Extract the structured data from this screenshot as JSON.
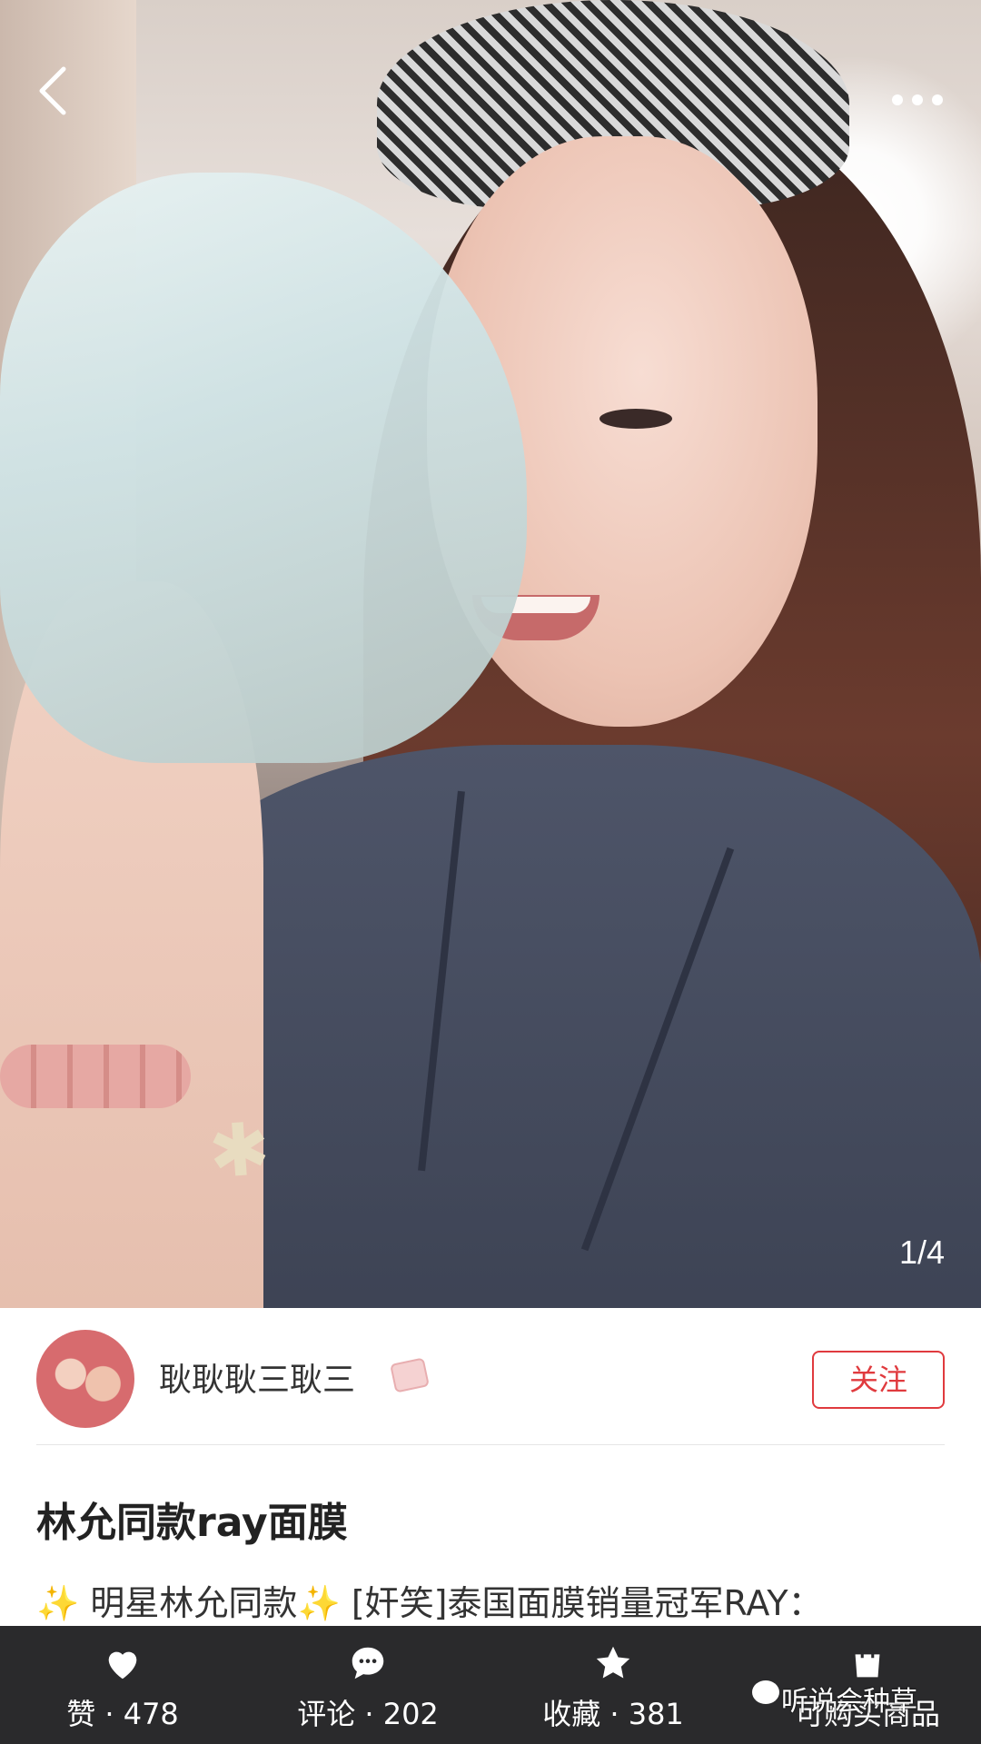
{
  "post": {
    "image_counter": "1/4",
    "author_name": "耿耿耿三耿三",
    "follow_label": "关注",
    "title": "林允同款ray面膜",
    "body_line": "明星林允同款",
    "body_line_rest": "[奸笑]泰国面膜销量冠军RAY："
  },
  "icons": {
    "back": "back-chevron-icon",
    "more": "more-dots-icon",
    "like": "heart-icon",
    "comment": "comment-bubble-icon",
    "collect": "star-icon",
    "shop": "shopping-bag-icon",
    "sparkle": "sparkle-icon"
  },
  "bottom_bar": {
    "like_label": "赞 · 478",
    "comment_label": "评论 · 202",
    "collect_label": "收藏 · 381",
    "shop_label": "可购买商品"
  },
  "watermark": {
    "text": "听说会种草"
  },
  "colors": {
    "accent": "#e03a3e",
    "bar_bg": "#2a2a2c",
    "sparkle": "#f5c518"
  }
}
